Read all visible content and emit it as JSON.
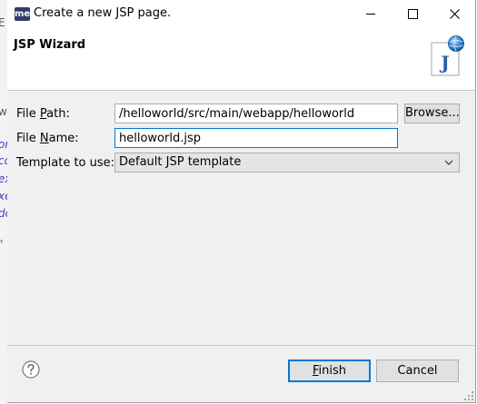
{
  "window": {
    "title": "Create a new JSP page.",
    "app_icon_text": "me"
  },
  "header": {
    "title": "JSP Wizard",
    "banner_icon_letter": "J"
  },
  "form": {
    "file_path": {
      "label_before": "File ",
      "label_mnemonic": "P",
      "label_after": "ath:",
      "value": "/helloworld/src/main/webapp/helloworld"
    },
    "browse_label": "Browse...",
    "file_name": {
      "label_before": "File ",
      "label_mnemonic": "N",
      "label_after": "ame:",
      "value": "helloworld.jsp"
    },
    "template": {
      "label": "Template to use:",
      "selected": "Default JSP template"
    }
  },
  "footer": {
    "finish_mnemonic": "F",
    "finish_rest": "inish",
    "cancel_label": "Cancel"
  },
  "background": {
    "fragments": [
      "E",
      "w",
      "or",
      "cc",
      "ex",
      "xe",
      "de",
      "\""
    ]
  },
  "colors": {
    "accent": "#0078d7",
    "dialog_bg": "#f0f0f0",
    "app_icon_bg": "#2c3e6b"
  }
}
